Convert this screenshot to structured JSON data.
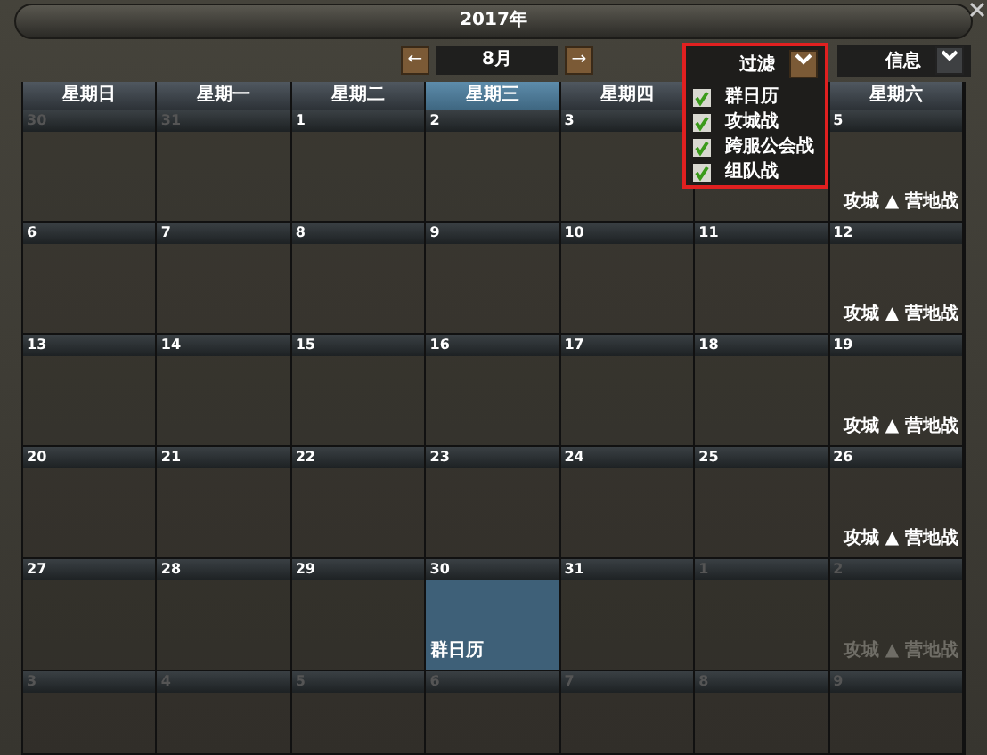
{
  "window": {
    "title": "2017年"
  },
  "month_nav": {
    "prev": "←",
    "month": "8月",
    "next": "→"
  },
  "filter": {
    "label": "过滤",
    "items": [
      {
        "label": "群日历",
        "checked": true
      },
      {
        "label": "攻城战",
        "checked": true
      },
      {
        "label": "跨服公会战",
        "checked": true
      },
      {
        "label": "组队战",
        "checked": true
      }
    ]
  },
  "info": {
    "label": "信息"
  },
  "weekdays": [
    {
      "label": "星期日",
      "selected": false
    },
    {
      "label": "星期一",
      "selected": false
    },
    {
      "label": "星期二",
      "selected": false
    },
    {
      "label": "星期三",
      "selected": true
    },
    {
      "label": "星期四",
      "selected": false
    },
    {
      "label": "星期六",
      "selected": false
    }
  ],
  "weeks": [
    [
      {
        "day": "30",
        "muted": true,
        "selected": false
      },
      {
        "day": "31",
        "muted": true,
        "selected": false
      },
      {
        "day": "1",
        "muted": false,
        "selected": false
      },
      {
        "day": "2",
        "muted": false,
        "selected": false
      },
      {
        "day": "3",
        "muted": false,
        "selected": false
      },
      {
        "selected": false
      },
      {
        "day": "5",
        "muted": false,
        "selected": false,
        "event": "攻城 ▲ 营地战"
      }
    ],
    [
      {
        "day": "6",
        "muted": false,
        "selected": false
      },
      {
        "day": "7",
        "muted": false,
        "selected": false
      },
      {
        "day": "8",
        "muted": false,
        "selected": false
      },
      {
        "day": "9",
        "muted": false,
        "selected": false
      },
      {
        "day": "10",
        "muted": false,
        "selected": false
      },
      {
        "day": "11",
        "muted": false,
        "selected": false
      },
      {
        "day": "12",
        "muted": false,
        "selected": false,
        "event": "攻城 ▲ 营地战"
      }
    ],
    [
      {
        "day": "13",
        "muted": false,
        "selected": false
      },
      {
        "day": "14",
        "muted": false,
        "selected": false
      },
      {
        "day": "15",
        "muted": false,
        "selected": false
      },
      {
        "day": "16",
        "muted": false,
        "selected": false
      },
      {
        "day": "17",
        "muted": false,
        "selected": false
      },
      {
        "day": "18",
        "muted": false,
        "selected": false
      },
      {
        "day": "19",
        "muted": false,
        "selected": false,
        "event": "攻城 ▲ 营地战"
      }
    ],
    [
      {
        "day": "20",
        "muted": false,
        "selected": false
      },
      {
        "day": "21",
        "muted": false,
        "selected": false
      },
      {
        "day": "22",
        "muted": false,
        "selected": false
      },
      {
        "day": "23",
        "muted": false,
        "selected": false
      },
      {
        "day": "24",
        "muted": false,
        "selected": false
      },
      {
        "day": "25",
        "muted": false,
        "selected": false
      },
      {
        "day": "26",
        "muted": false,
        "selected": false,
        "event": "攻城 ▲ 营地战"
      }
    ],
    [
      {
        "day": "27",
        "muted": false,
        "selected": false
      },
      {
        "day": "28",
        "muted": false,
        "selected": false
      },
      {
        "day": "29",
        "muted": false,
        "selected": false
      },
      {
        "day": "30",
        "muted": false,
        "selected": true,
        "event": "群日历"
      },
      {
        "day": "31",
        "muted": false,
        "selected": false
      },
      {
        "day": "1",
        "muted": true,
        "selected": false
      },
      {
        "day": "2",
        "muted": true,
        "selected": false,
        "event": "攻城 ▲ 营地战"
      }
    ],
    [
      {
        "day": "3",
        "muted": true,
        "selected": false
      },
      {
        "day": "4",
        "muted": true,
        "selected": false
      },
      {
        "day": "5",
        "muted": true,
        "selected": false
      },
      {
        "day": "6",
        "muted": true,
        "selected": false
      },
      {
        "day": "7",
        "muted": true,
        "selected": false
      },
      {
        "day": "8",
        "muted": true,
        "selected": false
      },
      {
        "day": "9",
        "muted": true,
        "selected": false
      }
    ]
  ]
}
